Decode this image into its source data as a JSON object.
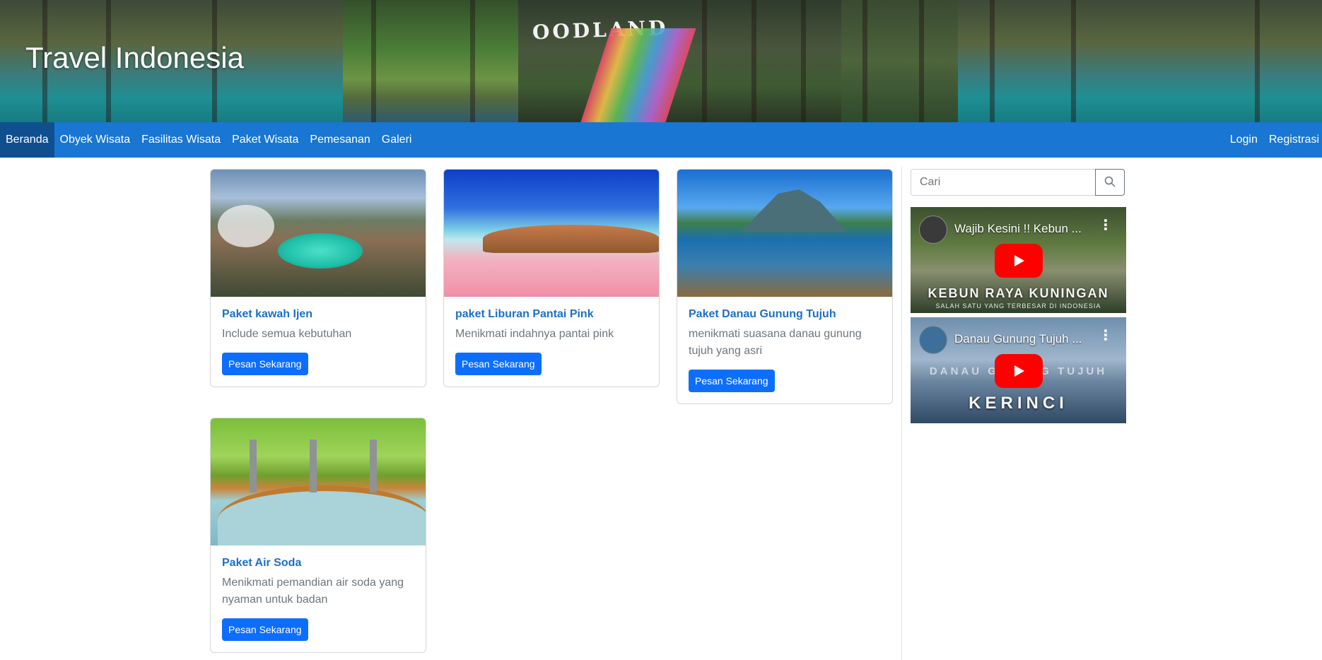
{
  "site": {
    "title": "Travel Indonesia",
    "banner_sign": "OODLAND"
  },
  "nav": {
    "left": [
      {
        "label": "Beranda",
        "active": true
      },
      {
        "label": "Obyek Wisata"
      },
      {
        "label": "Fasilitas Wisata"
      },
      {
        "label": "Paket Wisata"
      },
      {
        "label": "Pemesanan"
      },
      {
        "label": "Galeri"
      }
    ],
    "right": [
      {
        "label": "Login"
      },
      {
        "label": "Registrasi"
      }
    ]
  },
  "cards": [
    {
      "title": "Paket kawah Ijen",
      "text": "Include semua kebutuhan",
      "button": "Pesan Sekarang"
    },
    {
      "title": "paket Liburan Pantai Pink",
      "text": "Menikmati indahnya pantai pink",
      "button": "Pesan Sekarang"
    },
    {
      "title": "Paket Danau Gunung Tujuh",
      "text": "menikmati suasana danau gunung tujuh yang asri",
      "button": "Pesan Sekarang"
    },
    {
      "title": "Paket Air Soda",
      "text": "Menikmati pemandian air soda yang nyaman untuk badan",
      "button": "Pesan Sekarang"
    }
  ],
  "sidebar": {
    "search": {
      "placeholder": "Cari",
      "icon": "search-icon"
    },
    "videos": [
      {
        "title": "Wajib Kesini !! Kebun ...",
        "caption": "KEBUN RAYA KUNINGAN",
        "subcaption": "SALAH SATU YANG TERBESAR DI INDONESIA"
      },
      {
        "title": "Danau Gunung Tujuh ...",
        "caption_top": "DANAU GUNUNG TUJUH",
        "caption": "KERINCI"
      }
    ]
  },
  "colors": {
    "navbar": "#1976d2",
    "nav_active": "#0f4f8f",
    "button": "#0d6efd",
    "card_title": "#1e6fc7"
  }
}
